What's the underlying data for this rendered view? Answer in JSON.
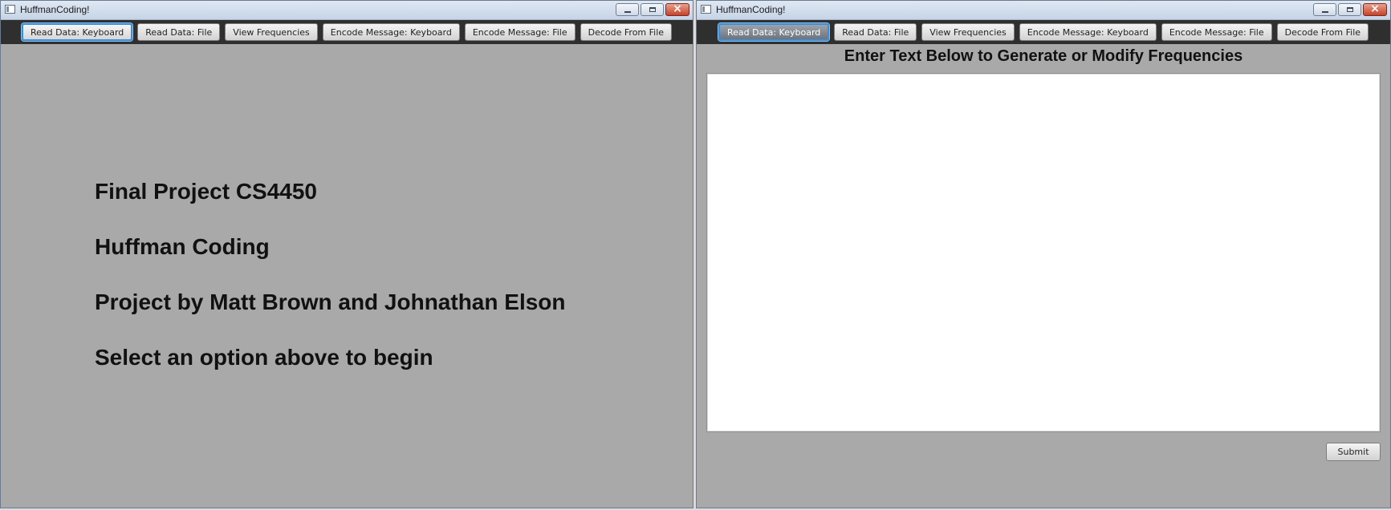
{
  "windows": [
    {
      "title": "HuffmanCoding!",
      "toolbar": [
        "Read Data: Keyboard",
        "Read Data: File",
        "View Frequencies",
        "Encode Message: Keyboard",
        "Encode Message: File",
        "Decode From File"
      ],
      "intro": {
        "line1": "Final Project CS4450",
        "line2": "Huffman Coding",
        "line3": "Project by Matt Brown and Johnathan Elson",
        "line4": "Select an option above to begin"
      }
    },
    {
      "title": "HuffmanCoding!",
      "toolbar": [
        "Read Data: Keyboard",
        "Read Data: File",
        "View Frequencies",
        "Encode Message: Keyboard",
        "Encode Message: File",
        "Decode From File"
      ],
      "section_title": "Enter Text Below to Generate or Modify Frequencies",
      "text_area_value": "",
      "submit_label": "Submit"
    }
  ],
  "icons": {
    "close": "×"
  },
  "colors": {
    "toolbar_bg": "#2f2f2f",
    "content_bg": "#a9a9a9",
    "focus_ring": "#3a8fdc"
  }
}
